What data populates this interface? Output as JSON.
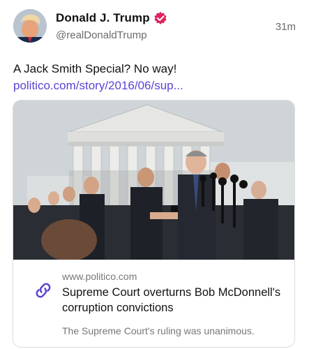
{
  "author": {
    "name": "Donald J. Trump",
    "handle": "@realDonaldTrump",
    "verified": true
  },
  "timestamp": "31m",
  "post": {
    "text": "A Jack Smith Special? No way! ",
    "link_text": "politico.com/story/2016/06/sup..."
  },
  "link_card": {
    "domain": "www.politico.com",
    "title": "Supreme Court overturns Bob McDonnell's corruption convictions",
    "description": "The Supreme Court's ruling was unanimous.",
    "icon": "link-icon"
  },
  "colors": {
    "link": "#5b43d6",
    "verified_badge": "#e0245e"
  }
}
